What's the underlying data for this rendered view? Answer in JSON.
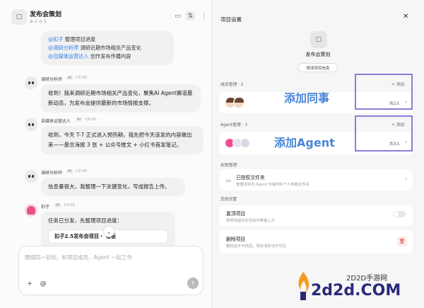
{
  "chat": {
    "title": "发布会策划",
    "meta": "⊕ 2 ◎ 3",
    "task_lines": [
      {
        "mention": "@扣子",
        "text": "整理项目进度"
      },
      {
        "mention": "@调研分析师",
        "text": "调研近期市场相关产品变化"
      },
      {
        "mention": "@自媒体运营达人",
        "text": "创作发布传播内容"
      }
    ],
    "messages": [
      {
        "sender": "调研分析师",
        "ai": "AI",
        "time": "19:08",
        "text": "收到！我来调研近期市场相关产品变化，聚焦AI Agent赛道最新动态，为发布会提供最新的市场情报支撑。"
      },
      {
        "sender": "自媒体运营达人",
        "ai": "AI",
        "time": "19:08",
        "text": "收到，今天 T-7 正式进入预热期，我先把今天该发的内容做出来——悬念海报 3 张 + 公众号推文 + 小红书首发笔记。"
      },
      {
        "sender": "调研分析师",
        "ai": "AI",
        "time": "19:08",
        "text": "信息量很大，我整理一下关键变化，写成报告上传。"
      },
      {
        "sender": "扣子",
        "ai": "AI",
        "time": "19:08",
        "text": "任务已分发，先整理项目进度："
      }
    ],
    "report_card": "扣子2.5发布会项目・   看板",
    "composer_placeholder": "围绕同一目标，和项目成员、Agent 一起工作",
    "plus": "+",
    "at": "@",
    "send": "↑"
  },
  "settings": {
    "title": "项目设置",
    "project_name": "发布会策划",
    "edit_btn": "修改项目信息",
    "members_label": "成员管理 · 2",
    "members_add": "+ 添加",
    "members_count": "共2人",
    "agents_label": "Agent管理 · 3",
    "agents_add": "+ 添加",
    "agents_count": "共3人",
    "perm_label": "权限管理",
    "folder_title": "已授权文件夹",
    "folder_sub": "管理项目内 Agent 可操作的个人电脑文件夹",
    "other_label": "其他设置",
    "pin_title": "置顶项目",
    "pin_sub": "将项目固定在项目列表最上方",
    "delete_title": "删除项目",
    "delete_sub": "删除后不可找回，项目消息也不可见"
  },
  "annotations": {
    "add_member": "添加同事",
    "add_agent": "添加Agent"
  },
  "watermark": {
    "top": "2D2D手游网",
    "main": "2d2d.COM"
  },
  "colors": {
    "mention": "#2f80ed",
    "annotation_box": "#8f7bd8",
    "annotation_text": "#4a86d8",
    "agent_pink": "#ec4f8a",
    "danger": "#e04545"
  },
  "icons": {
    "close": "✕",
    "chevron": "›",
    "folder": "▭",
    "tune": "⇅",
    "more": "⋮",
    "trash": "🗑",
    "scroll_down": "⌄"
  }
}
